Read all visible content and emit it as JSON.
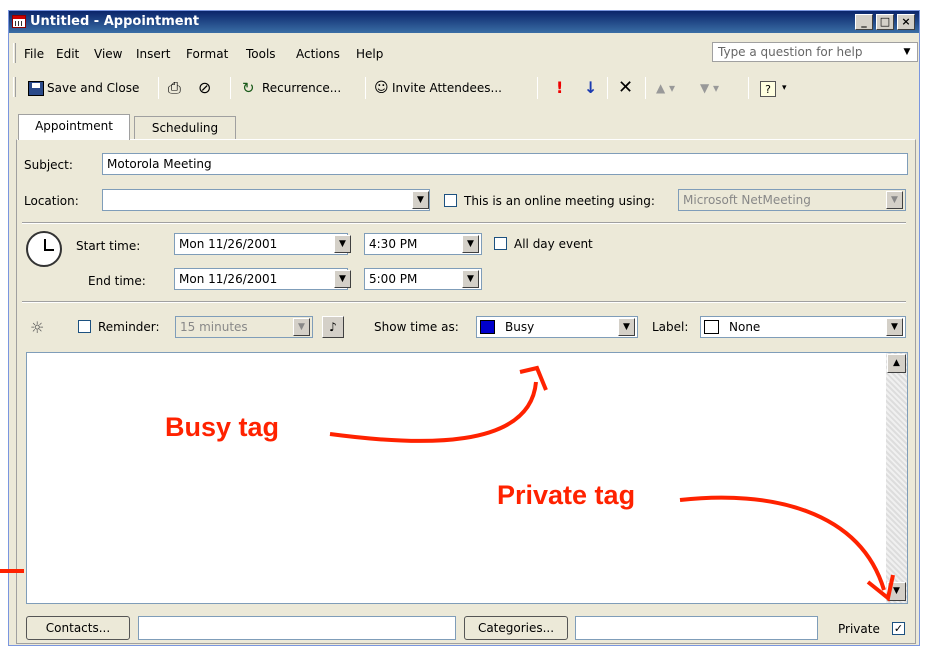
{
  "window": {
    "title": "Untitled - Appointment",
    "min": "_",
    "max": "□",
    "close": "×"
  },
  "menu": [
    "File",
    "Edit",
    "View",
    "Insert",
    "Format",
    "Tools",
    "Actions",
    "Help"
  ],
  "help_box": {
    "placeholder": "Type a question for help"
  },
  "toolbar": {
    "save_close": "Save and Close",
    "recurrence": "Recurrence...",
    "invite": "Invite Attendees...",
    "high_importance": "!",
    "low_importance": "↓"
  },
  "tabs": [
    "Appointment",
    "Scheduling"
  ],
  "form": {
    "subject_label": "Subject:",
    "subject_value": "Motorola Meeting",
    "location_label": "Location:",
    "location_value": "",
    "online_label": "This is an online meeting using:",
    "online_value": "Microsoft NetMeeting",
    "start_label": "Start time:",
    "start_date": "Mon 11/26/2001",
    "start_time": "4:30 PM",
    "allday_label": "All day event",
    "end_label": "End time:",
    "end_date": "Mon 11/26/2001",
    "end_time": "5:00 PM",
    "reminder_label": "Reminder:",
    "reminder_value": "15 minutes",
    "showtime_label": "Show time as:",
    "showtime_value": "Busy",
    "showtime_color": "#0000cc",
    "label_label": "Label:",
    "label_value": "None"
  },
  "footer": {
    "contacts_button": "Contacts...",
    "categories_button": "Categories...",
    "private_label": "Private",
    "private_checked": "✓"
  },
  "annotations": {
    "busy": "Busy tag",
    "private": "Private tag",
    "color": "#ff2200"
  }
}
